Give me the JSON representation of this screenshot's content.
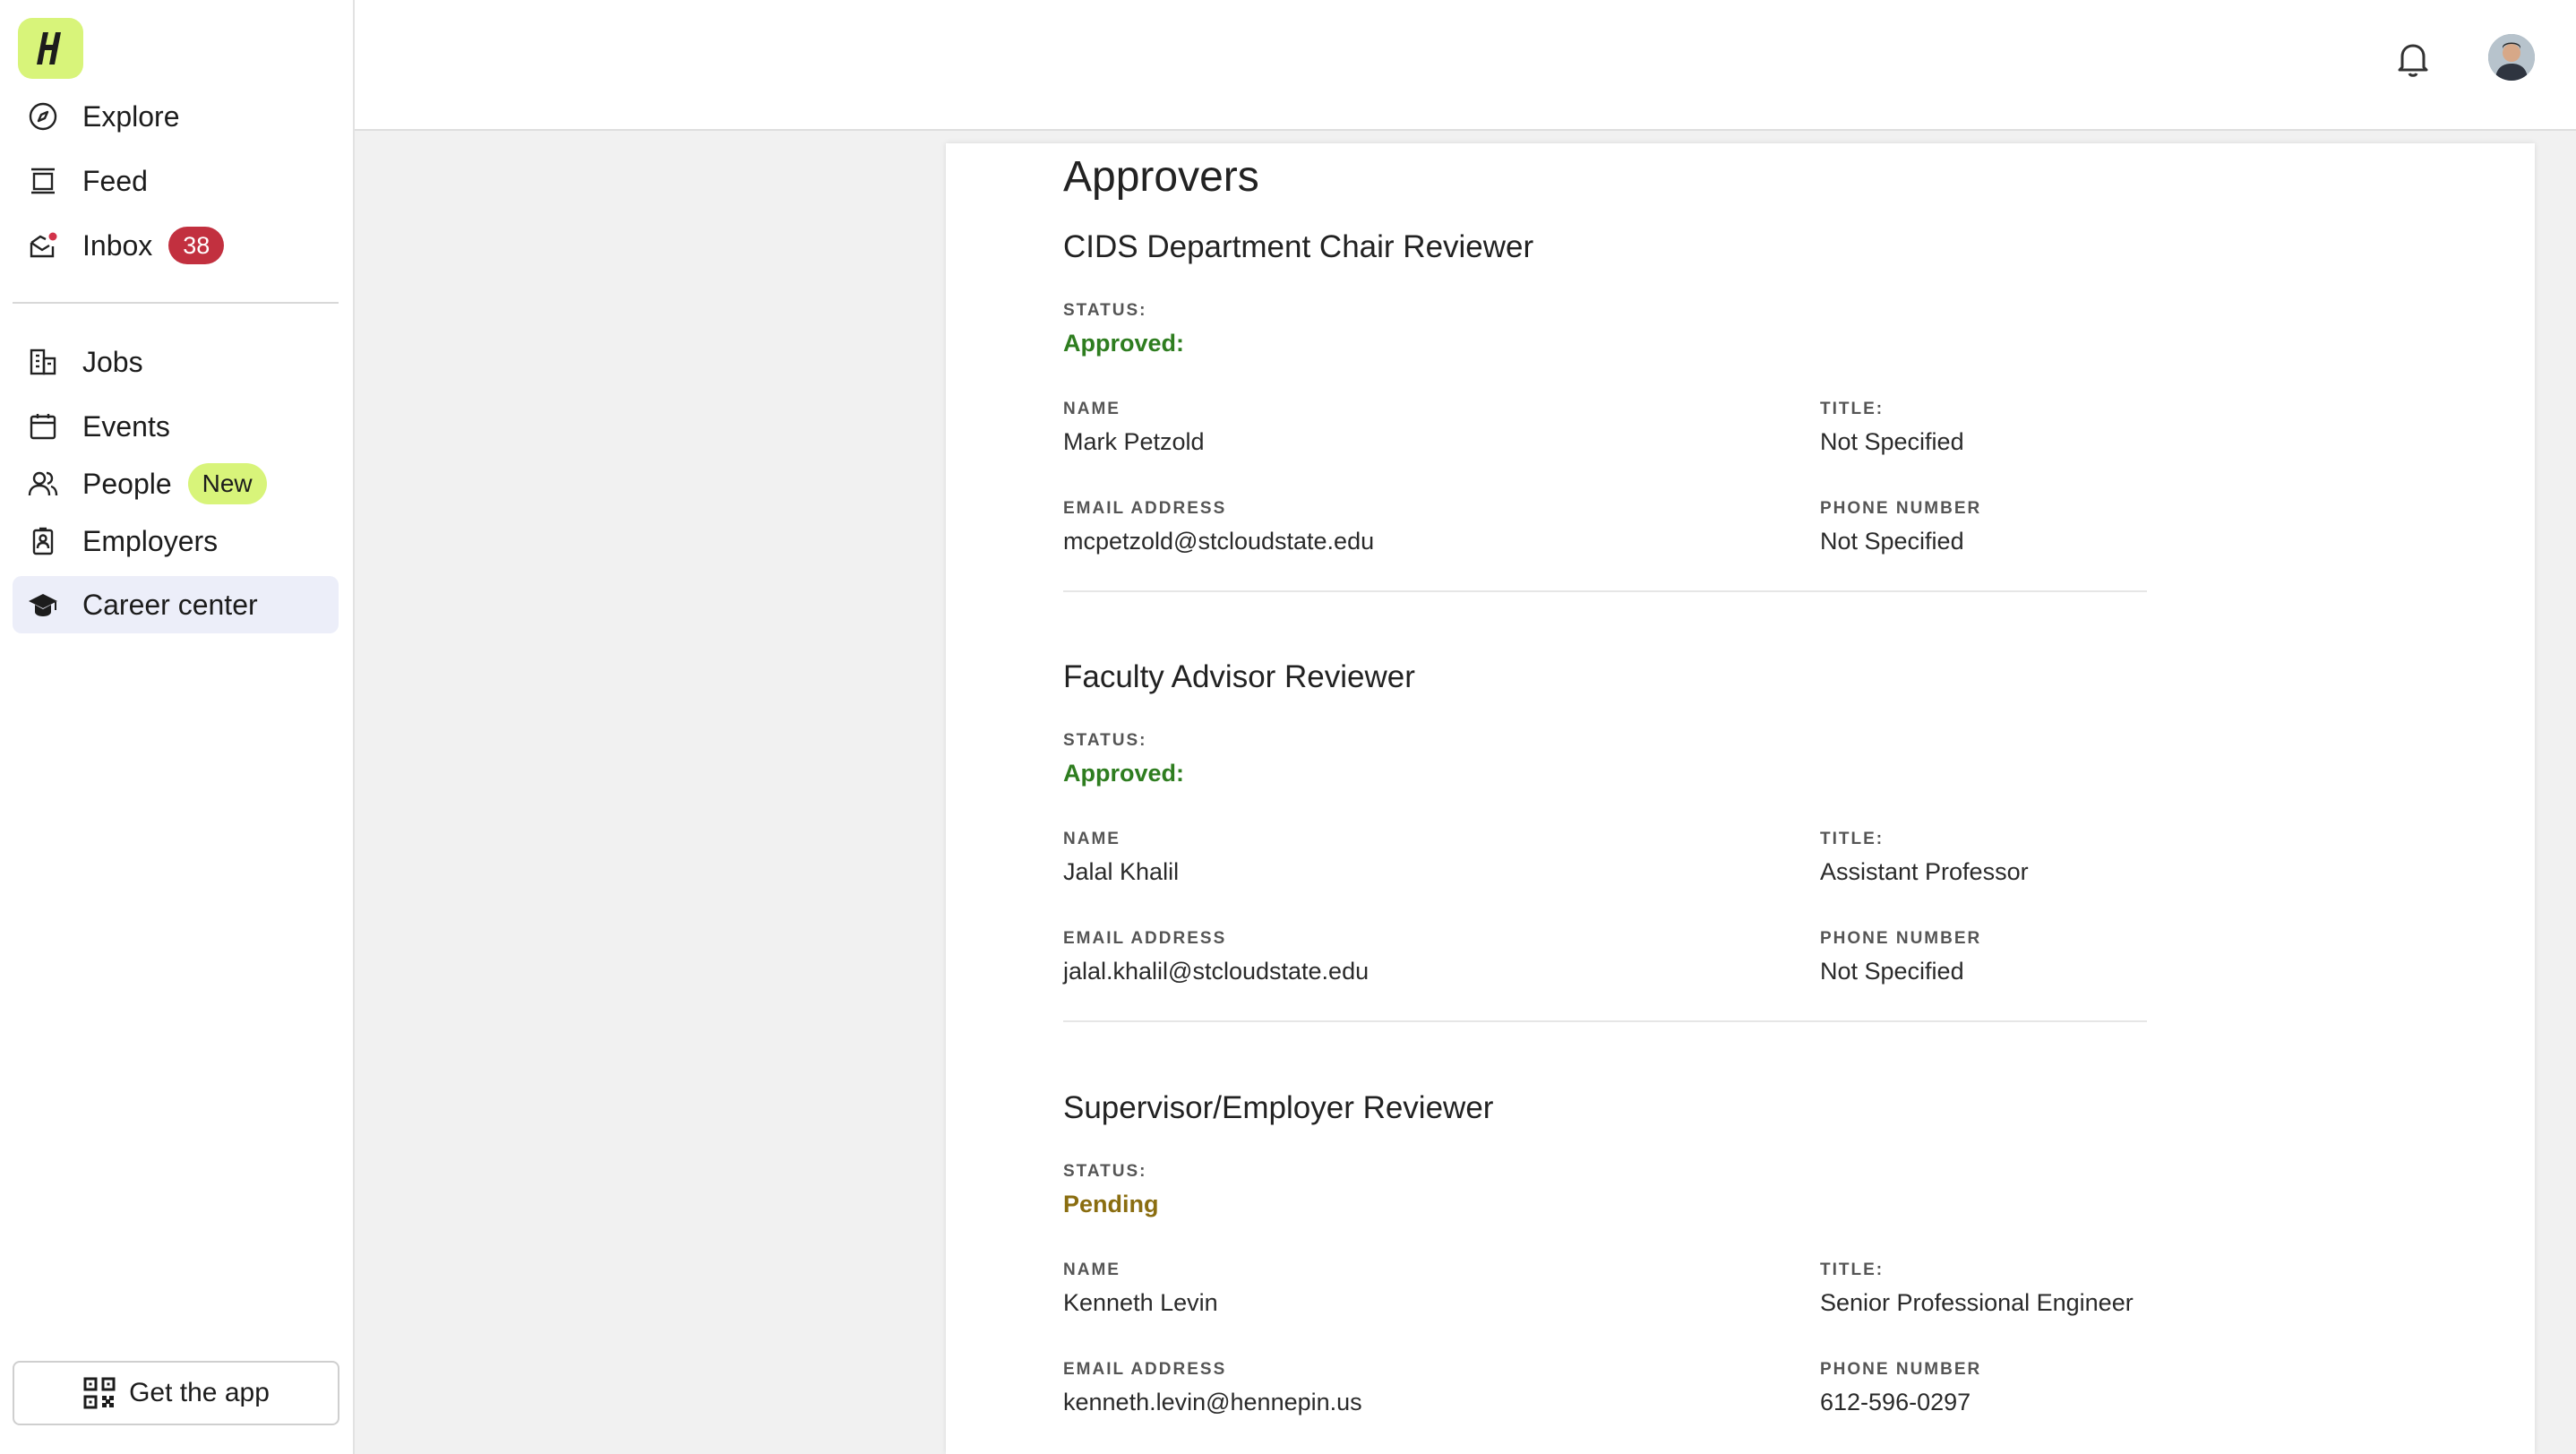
{
  "sidebar": {
    "logo_letter": "H",
    "nav": [
      {
        "label": "Explore",
        "icon": "compass-icon"
      },
      {
        "label": "Feed",
        "icon": "feed-icon"
      },
      {
        "label": "Inbox",
        "icon": "inbox-icon",
        "badge": "38"
      },
      {
        "label": "Jobs",
        "icon": "building-icon"
      },
      {
        "label": "Events",
        "icon": "calendar-icon"
      },
      {
        "label": "People",
        "icon": "people-icon",
        "badge": "New"
      },
      {
        "label": "Employers",
        "icon": "badge-icon"
      },
      {
        "label": "Career center",
        "icon": "graduation-cap-icon",
        "active": true
      }
    ],
    "get_app_label": "Get the app"
  },
  "topbar": {
    "notifications_icon": "bell-icon",
    "avatar_icon": "user-avatar"
  },
  "main": {
    "section_title": "Approvers",
    "labels": {
      "status": "STATUS:",
      "name": "NAME",
      "title": "TITLE:",
      "email": "EMAIL ADDRESS",
      "phone": "PHONE NUMBER"
    },
    "approvers": [
      {
        "role": "CIDS Department Chair Reviewer",
        "status": "Approved:",
        "name": "Mark Petzold",
        "title": "Not Specified",
        "email": "mcpetzold@stcloudstate.edu",
        "phone": "Not Specified"
      },
      {
        "role": "Faculty Advisor Reviewer",
        "status": "Approved:",
        "name": "Jalal Khalil",
        "title": "Assistant Professor",
        "email": "jalal.khalil@stcloudstate.edu",
        "phone": "Not Specified"
      },
      {
        "role": "Supervisor/Employer Reviewer",
        "status": "Pending",
        "name": "Kenneth Levin",
        "title": "Senior Professional Engineer",
        "email": "kenneth.levin@hennepin.us",
        "phone": "612-596-0297"
      }
    ]
  },
  "colors": {
    "brand_lime": "#d8f47a",
    "badge_red": "#c2303f",
    "approved_green": "#2e7d1f",
    "pending_amber": "#8a6d10",
    "active_nav_bg": "#eceef9"
  }
}
